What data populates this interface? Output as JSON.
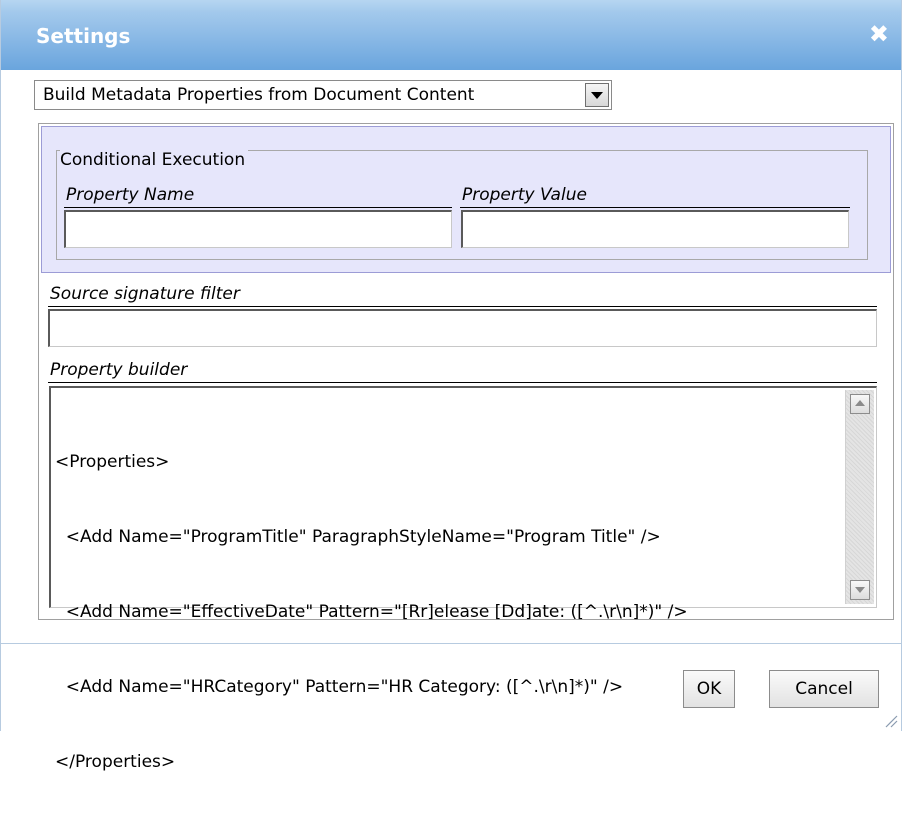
{
  "dialog": {
    "title": "Settings",
    "close_glyph": "✖"
  },
  "action_select": {
    "selected": "Build Metadata Properties from Document Content"
  },
  "conditional": {
    "legend": "Conditional Execution",
    "property_name_label": "Property Name",
    "property_name_value": "",
    "property_value_label": "Property Value",
    "property_value_value": ""
  },
  "source_filter": {
    "label": "Source signature filter",
    "value": ""
  },
  "property_builder": {
    "label": "Property builder",
    "lines": [
      "<Properties>",
      "  <Add Name=\"ProgramTitle\" ParagraphStyleName=\"Program Title\" />",
      "  <Add Name=\"EffectiveDate\" Pattern=\"[Rr]elease [Dd]ate: ([^.\\r\\n]*)\" />",
      "  <Add Name=\"HRCategory\" Pattern=\"HR Category: ([^.\\r\\n]*)\" />",
      "</Properties>"
    ]
  },
  "buttons": {
    "ok": "OK",
    "cancel": "Cancel"
  },
  "icons": {
    "close": "close-icon",
    "dropdown": "chevron-down-icon",
    "scroll_up": "scroll-up-icon",
    "scroll_down": "scroll-down-icon",
    "resize": "resize-grip-icon"
  },
  "colors": {
    "titlebar": "#74abe0",
    "conditional_panel": "#e6e6fb",
    "divider": "#b7cbe0"
  }
}
